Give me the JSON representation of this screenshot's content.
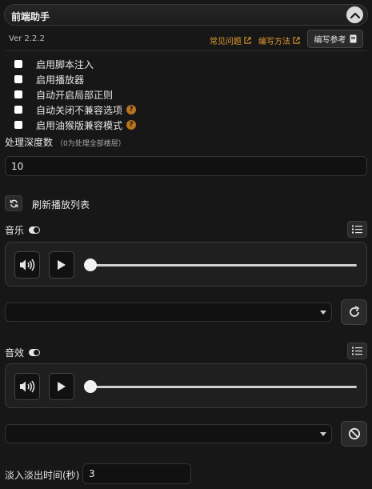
{
  "header": {
    "title": "前端助手",
    "version": "Ver 2.2.2",
    "links": [
      {
        "label": "常见问题",
        "icon": "external-link-icon"
      },
      {
        "label": "编写方法",
        "icon": "external-link-icon"
      }
    ],
    "reference_button": "编写参考"
  },
  "options": [
    {
      "label": "启用脚本注入",
      "checked": false,
      "help": false
    },
    {
      "label": "启用播放器",
      "checked": false,
      "help": false
    },
    {
      "label": "自动开启局部正则",
      "checked": false,
      "help": false
    },
    {
      "label": "自动关闭不兼容选项",
      "checked": false,
      "help": true
    },
    {
      "label": "启用油猴版兼容模式",
      "checked": false,
      "help": true
    }
  ],
  "help_glyph": "?",
  "depth": {
    "label": "处理深度数",
    "hint": "（0为处理全部楼层）",
    "value": "10"
  },
  "refresh_playlist": {
    "label": "刷新播放列表"
  },
  "music": {
    "label": "音乐",
    "toggle_on": true,
    "progress": 0,
    "selected": ""
  },
  "sfx": {
    "label": "音效",
    "toggle_on": true,
    "progress": 0,
    "selected": ""
  },
  "fade": {
    "label": "淡入淡出时间(秒)",
    "value": "3"
  },
  "colors": {
    "accent": "#e39b2e",
    "help": "#b9731f",
    "background": "#171717"
  }
}
